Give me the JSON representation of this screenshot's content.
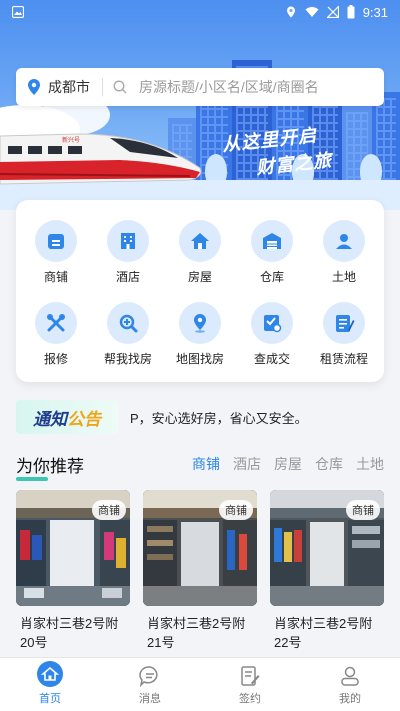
{
  "status_bar": {
    "time": "9:31"
  },
  "search": {
    "city": "成都市",
    "placeholder": "房源标题/小区名/区域/商圈名"
  },
  "banner": {
    "slogan_line1": "从这里开启",
    "slogan_line2": "财富之旅",
    "train_label": "新兴号"
  },
  "categories": [
    {
      "label": "商铺",
      "icon": "shop-icon"
    },
    {
      "label": "酒店",
      "icon": "hotel-icon"
    },
    {
      "label": "房屋",
      "icon": "house-icon"
    },
    {
      "label": "仓库",
      "icon": "warehouse-icon"
    },
    {
      "label": "土地",
      "icon": "land-icon"
    },
    {
      "label": "报修",
      "icon": "repair-icon"
    },
    {
      "label": "帮我找房",
      "icon": "find-house-icon"
    },
    {
      "label": "地图找房",
      "icon": "map-pin-icon"
    },
    {
      "label": "查成交",
      "icon": "deal-icon"
    },
    {
      "label": "租赁流程",
      "icon": "lease-process-icon"
    }
  ],
  "notice": {
    "tag_part1": "通知",
    "tag_part2": "公告",
    "text": "P，安心选好房，省心又安全。"
  },
  "recommend": {
    "title": "为你推荐",
    "tabs": [
      "商铺",
      "酒店",
      "房屋",
      "仓库",
      "土地"
    ],
    "active_tab": 0,
    "items": [
      {
        "tag": "商铺",
        "title": "肖家村三巷2号附20号"
      },
      {
        "tag": "商铺",
        "title": "肖家村三巷2号附21号"
      },
      {
        "tag": "商铺",
        "title": "肖家村三巷2号附22号"
      }
    ]
  },
  "tabbar": [
    {
      "label": "首页",
      "icon": "home-icon",
      "active": true
    },
    {
      "label": "消息",
      "icon": "message-icon",
      "active": false
    },
    {
      "label": "签约",
      "icon": "sign-icon",
      "active": false
    },
    {
      "label": "我的",
      "icon": "profile-icon",
      "active": false
    }
  ],
  "colors": {
    "primary": "#2d86e8",
    "accent_teal": "#3bc7b0",
    "notice_yellow": "#f0a515"
  }
}
